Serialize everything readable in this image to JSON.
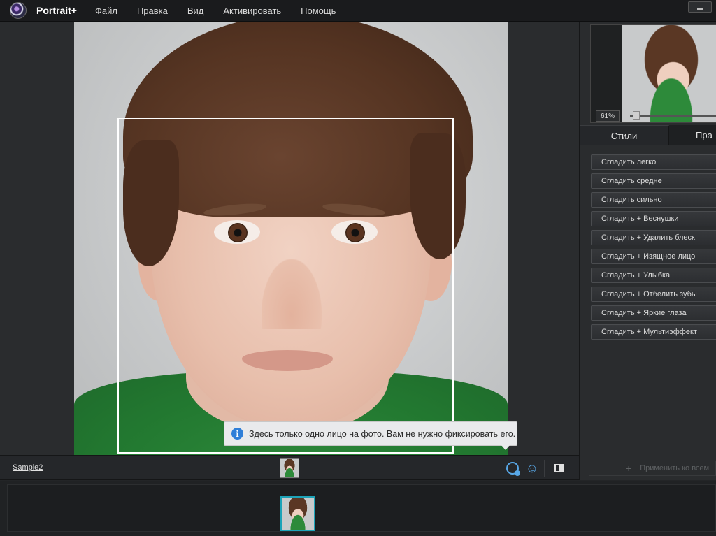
{
  "app": {
    "title": "Portrait+"
  },
  "menu": {
    "items": [
      "Файл",
      "Правка",
      "Вид",
      "Активировать",
      "Помощь"
    ]
  },
  "canvas": {
    "tooltip": "Здесь только одно лицо на фото. Вам не нужно фиксировать его."
  },
  "preview": {
    "zoom": "61%"
  },
  "panel": {
    "tabs": [
      "Стили",
      "Пра"
    ],
    "styles": [
      "Сгладить легко",
      "Сгладить средне",
      "Сгладить сильно",
      "Сгладить + Веснушки",
      "Сгладить + Удалить блеск",
      "Сгладить + Изящное лицо",
      "Сгладить + Улыбка",
      "Сгладить + Отбелить зубы",
      "Сгладить + Яркие глаза",
      "Сгладить + Мультиэффект"
    ],
    "apply_all": "Применить ко всем"
  },
  "bottom": {
    "file_name": "Sample2"
  },
  "colors": {
    "accent": "#58a8e8",
    "thumb_border": "#1da3b8",
    "info": "#2f7fd8"
  }
}
